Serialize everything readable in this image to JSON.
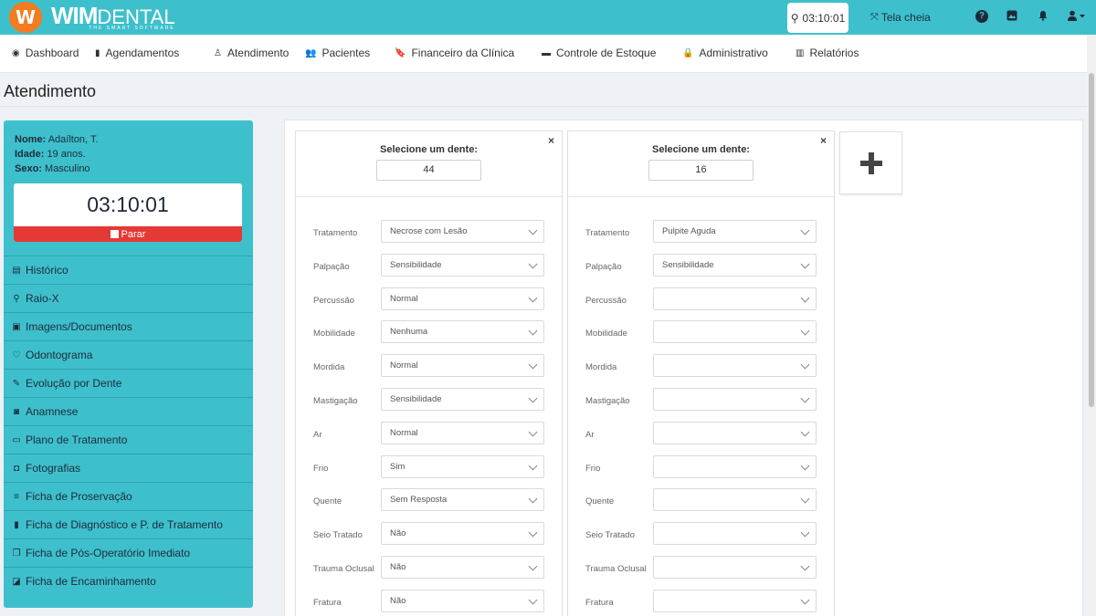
{
  "brand": {
    "logo_mark": "W",
    "name": "WIM",
    "name_sub": "DENTAL",
    "tagline": "THE SMART SOFTWARE",
    "accent": "#3ec0cc",
    "logo_color": "#f47b20"
  },
  "topbar": {
    "timer": "03:10:01",
    "fullscreen_label": "Tela cheia",
    "icons": [
      "help-icon",
      "picture-icon",
      "bell-icon",
      "user-icon"
    ]
  },
  "nav": [
    {
      "label": "Dashboard",
      "icon": "dashboard-icon"
    },
    {
      "label": "Agendamentos",
      "icon": "book-icon"
    },
    {
      "label": "Atendimento",
      "icon": "doctor-icon"
    },
    {
      "label": "Pacientes",
      "icon": "users-icon"
    },
    {
      "label": "Financeiro da Clínica",
      "icon": "bookmark-icon"
    },
    {
      "label": "Controle de Estoque",
      "icon": "box-icon"
    },
    {
      "label": "Administrativo",
      "icon": "lock-icon"
    },
    {
      "label": "Relatórios",
      "icon": "bar-chart-icon"
    }
  ],
  "page_title": "Atendimento",
  "patient": {
    "name_label": "Nome:",
    "name": "Adaílton, T.",
    "age_label": "Idade:",
    "age": "19 anos.",
    "sex_label": "Sexo:",
    "sex": "Masculino",
    "timer": "03:10:01",
    "stop_label": "Parar",
    "stop_color": "#e53935"
  },
  "sidebar_menu": [
    {
      "label": "Histórico",
      "icon": "clipboard-icon"
    },
    {
      "label": "Raio-X",
      "icon": "tooth-xray-icon"
    },
    {
      "label": "Imagens/Documentos",
      "icon": "image-icon"
    },
    {
      "label": "Odontograma",
      "icon": "tooth-icon"
    },
    {
      "label": "Evolução por Dente",
      "icon": "tooth-tool-icon"
    },
    {
      "label": "Anamnese",
      "icon": "portrait-icon"
    },
    {
      "label": "Plano de Tratamento",
      "icon": "money-icon"
    },
    {
      "label": "Fotografias",
      "icon": "camera-icon"
    },
    {
      "label": "Ficha de Proservação",
      "icon": "list-icon"
    },
    {
      "label": "Ficha de Diagnóstico e P. de Tratamento",
      "icon": "book-icon"
    },
    {
      "label": "Ficha de Pós-Operatório Imediato",
      "icon": "copy-icon"
    },
    {
      "label": "Ficha de Encaminhamento",
      "icon": "share-icon"
    }
  ],
  "tooth_cards": [
    {
      "title": "Selecione um dente:",
      "tooth": "44",
      "fields": [
        {
          "label": "Tratamento",
          "value": "Necrose com Lesão"
        },
        {
          "label": "Palpação",
          "value": "Sensibilidade"
        },
        {
          "label": "Percussão",
          "value": "Normal"
        },
        {
          "label": "Mobilidade",
          "value": "Nenhuma"
        },
        {
          "label": "Mordida",
          "value": "Normal"
        },
        {
          "label": "Mastigação",
          "value": "Sensibilidade"
        },
        {
          "label": "Ar",
          "value": "Normal"
        },
        {
          "label": "Frio",
          "value": "Sim"
        },
        {
          "label": "Quente",
          "value": "Sem Resposta"
        },
        {
          "label": "Seio Tratado",
          "value": "Não"
        },
        {
          "label": "Trauma Oclusal",
          "value": "Não"
        },
        {
          "label": "Fratura",
          "value": "Não"
        }
      ]
    },
    {
      "title": "Selecione um dente:",
      "tooth": "16",
      "fields": [
        {
          "label": "Tratamento",
          "value": "Pulpite Aguda"
        },
        {
          "label": "Palpação",
          "value": "Sensibilidade"
        },
        {
          "label": "Percussão",
          "value": ""
        },
        {
          "label": "Mobilidade",
          "value": ""
        },
        {
          "label": "Mordida",
          "value": ""
        },
        {
          "label": "Mastigação",
          "value": ""
        },
        {
          "label": "Ar",
          "value": ""
        },
        {
          "label": "Frio",
          "value": ""
        },
        {
          "label": "Quente",
          "value": ""
        },
        {
          "label": "Seio Tratado",
          "value": ""
        },
        {
          "label": "Trauma Oclusal",
          "value": ""
        },
        {
          "label": "Fratura",
          "value": ""
        }
      ]
    }
  ],
  "add_card_icon": "plus-icon",
  "close_glyph": "×"
}
